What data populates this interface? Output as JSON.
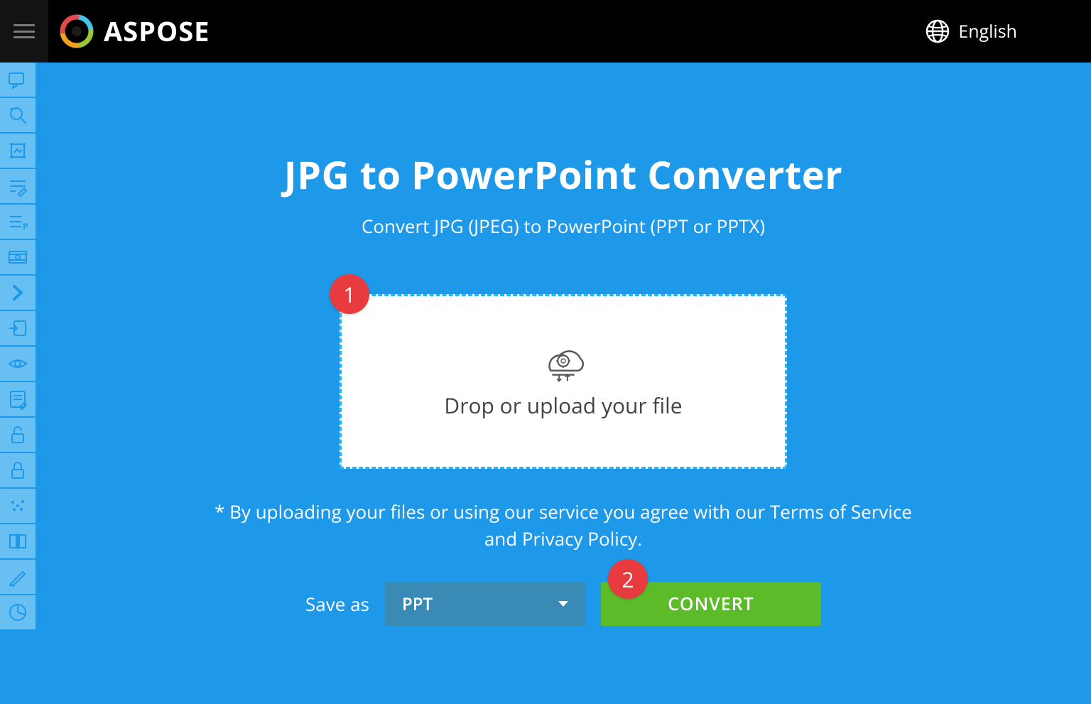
{
  "header": {
    "brand": "ASPOSE",
    "language": "English"
  },
  "sidebar": {
    "items": [
      {
        "name": "annotate-icon"
      },
      {
        "name": "search-icon"
      },
      {
        "name": "crop-icon"
      },
      {
        "name": "edit-line-icon"
      },
      {
        "name": "presentation-icon"
      },
      {
        "name": "video-icon"
      },
      {
        "name": "chevron-right-icon"
      },
      {
        "name": "import-icon"
      },
      {
        "name": "eye-icon"
      },
      {
        "name": "form-icon"
      },
      {
        "name": "unlock-icon"
      },
      {
        "name": "lock-icon"
      },
      {
        "name": "chart-dots-icon"
      },
      {
        "name": "split-icon"
      },
      {
        "name": "pen-icon"
      },
      {
        "name": "pie-chart-icon"
      }
    ]
  },
  "main": {
    "title": "JPG to PowerPoint Converter",
    "subtitle": "Convert JPG (JPEG) to PowerPoint (PPT or PPTX)",
    "drop_text": "Drop or upload your file",
    "terms": "* By uploading your files or using our service you agree with our Terms of Service and Privacy Policy.",
    "save_as_label": "Save as",
    "format_selected": "PPT",
    "convert_label": "CONVERT",
    "markers": {
      "one": "1",
      "two": "2"
    }
  }
}
